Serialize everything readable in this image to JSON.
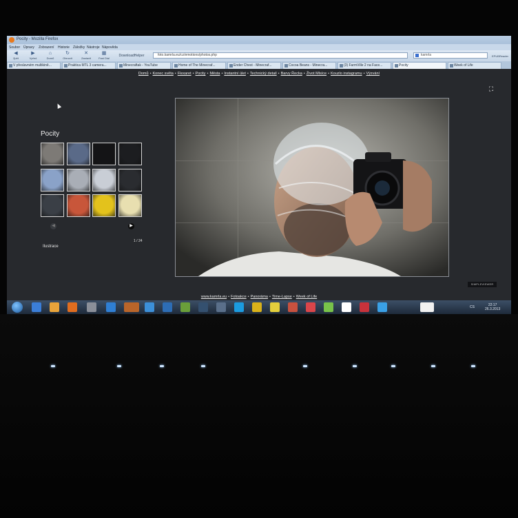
{
  "window": {
    "title": "Pocity - Mozilla Firefox",
    "menu": [
      "Soubor",
      "Úpravy",
      "Zobrazení",
      "Historie",
      "Záložky",
      "Nástroje",
      "Nápověda"
    ]
  },
  "toolbar": {
    "back_label": "Zpět",
    "forward_label": "Vpřed",
    "home_label": "Domů",
    "reload_label": "Obnovit",
    "stop_label": "Zastavit",
    "fast_dial_label": "Fast Dial",
    "download_helper_label": "DownloadHelper",
    "url": "foto.kamrla.eu/cz/emotions/photos.php",
    "search_value": "kamrla",
    "epub_label": "EPUBReader"
  },
  "tabs": [
    {
      "label": "V přeslavném multikině..."
    },
    {
      "label": "Praktica MTL 3 camera..."
    },
    {
      "label": "Minecraftak - YouTube"
    },
    {
      "label": "Home of The Minecraf..."
    },
    {
      "label": "Ender Chest - Minecraf..."
    },
    {
      "label": "Cocoa Beans - Minecra..."
    },
    {
      "label": "(3) FarmVille 2 na Face..."
    },
    {
      "label": "Pocity"
    },
    {
      "label": "Week of Life"
    }
  ],
  "topnav": [
    "Domů",
    "Konec světa",
    "Flexaret",
    "Pocity",
    "Města",
    "Instantní úlet",
    "Technický detail",
    "Barvy Řecka",
    "Život Mlsíce",
    "Kouzlo instagramu",
    "Výzvání"
  ],
  "gallery": {
    "title": "Pocity",
    "counter": "1 / 24",
    "caption": "Ilustrace",
    "prev_symbol": "◀",
    "next_symbol": "▶",
    "thumb_colors": [
      "#7d7a76",
      "#5a6a88",
      "#141416",
      "#1c1d20",
      "#8aa2c8",
      "#a9aeb6",
      "#c9ced6",
      "#2a2c30",
      "#3a3f46",
      "#c8563a",
      "#e3c21c",
      "#e8dfb0"
    ],
    "viewer_badge": "SIMPLEVIEWER"
  },
  "footnav": [
    "www.kamrla.eu",
    "Fotoakce",
    "Panoráma",
    "Time-Lapse",
    "Week of Life"
  ],
  "taskbar": {
    "icon_colors": [
      "#3b7ed8",
      "#e8a33a",
      "#e06d1f",
      "#8a8f99",
      "#2f7fd4",
      "#b9652a",
      "#3c8fd8",
      "#2d6db5",
      "#6a9f3a",
      "#34506f",
      "#5a6f8a",
      "#1b9be0",
      "#d9b21a",
      "#e3cf3c",
      "#c7513f",
      "#d9454a",
      "#78c24a",
      "#ffffff",
      "#c8323b",
      "#3aa0e6",
      "#f1f1f1"
    ],
    "lang": "CS",
    "time": "22:17",
    "date": "26.3.2013"
  },
  "colors": {
    "page_bg": "#27292d",
    "link": "#f0f0f0",
    "chrome": "#c8d8ea"
  }
}
